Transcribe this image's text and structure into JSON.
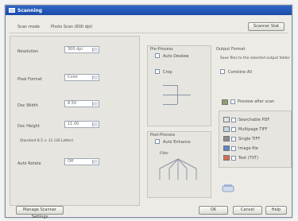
{
  "title": "Scanning",
  "header": {
    "left_label": "Scan mode",
    "left_value": "Photo Scan (600 dpi)",
    "right_button": "Scanner Stat"
  },
  "form": {
    "res_label": "Resolution",
    "res_value": "300 dpi",
    "pixel_label": "Pixel Format",
    "pixel_value": "Color",
    "size1_label": "Doc Width",
    "size1_value": "8.50",
    "size2_label": "Doc Height",
    "size2_value": "11.00",
    "note": "Standard 8.5 × 11 (US Letter)",
    "scale_label": "Auto Rotate",
    "scale_value": "Off"
  },
  "middle": {
    "group1_title": "Pre-Process",
    "group1_check1": "Auto Deskew",
    "group1_check2": "Crop",
    "group2_title": "Post-Process",
    "group2_check1": "Auto Enhance",
    "group2_sub": "Filter"
  },
  "right": {
    "group_title": "Output Format",
    "desc": "Save files to the selected output folder",
    "check1": "Combine All",
    "check_main": "Preview after scan",
    "list": [
      "Searchable PDF",
      "Multipage TIFF",
      "Single TIFF",
      "Image file",
      "Text (TXT)"
    ]
  },
  "footer": {
    "left_button": "Manage Scanner Settings",
    "ok": "OK",
    "cancel": "Cancel",
    "help": "Help"
  }
}
